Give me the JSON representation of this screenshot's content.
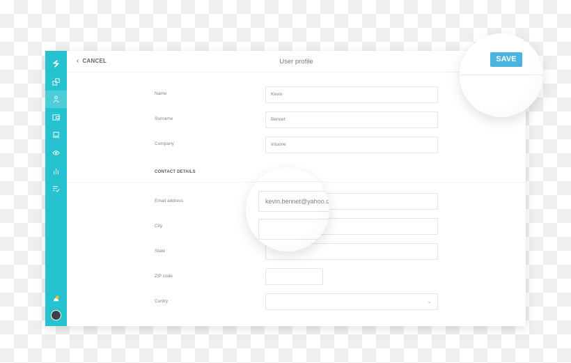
{
  "header": {
    "cancel_label": "CANCEL",
    "title": "User profile",
    "save_label": "SAVE"
  },
  "sidebar": {
    "items": [
      {
        "icon": "logo-icon"
      },
      {
        "icon": "copy-icon"
      },
      {
        "icon": "user-icon",
        "active": true
      },
      {
        "icon": "wallet-icon"
      },
      {
        "icon": "monitor-icon"
      },
      {
        "icon": "eye-icon"
      },
      {
        "icon": "bar-chart-icon"
      },
      {
        "icon": "checklist-icon"
      }
    ],
    "notification_icon": "notification-bell-icon",
    "avatar": "user-avatar"
  },
  "form": {
    "name": {
      "label": "Name",
      "value": "Kevin"
    },
    "surname": {
      "label": "Surname",
      "value": "Bennet"
    },
    "company": {
      "label": "Company",
      "value": "Intuone"
    },
    "section_title": "CONTACT DETAILS",
    "email": {
      "label": "Email address",
      "value": "kevin.bennet@yahoo.c"
    },
    "city": {
      "label": "City",
      "value": ""
    },
    "state": {
      "label": "State",
      "value": ""
    },
    "zip": {
      "label": "ZIP code",
      "value": ""
    },
    "country": {
      "label": "Cuntry",
      "value": ""
    }
  },
  "colors": {
    "sidebar": "#26c2cf",
    "save": "#4ab3e0"
  }
}
